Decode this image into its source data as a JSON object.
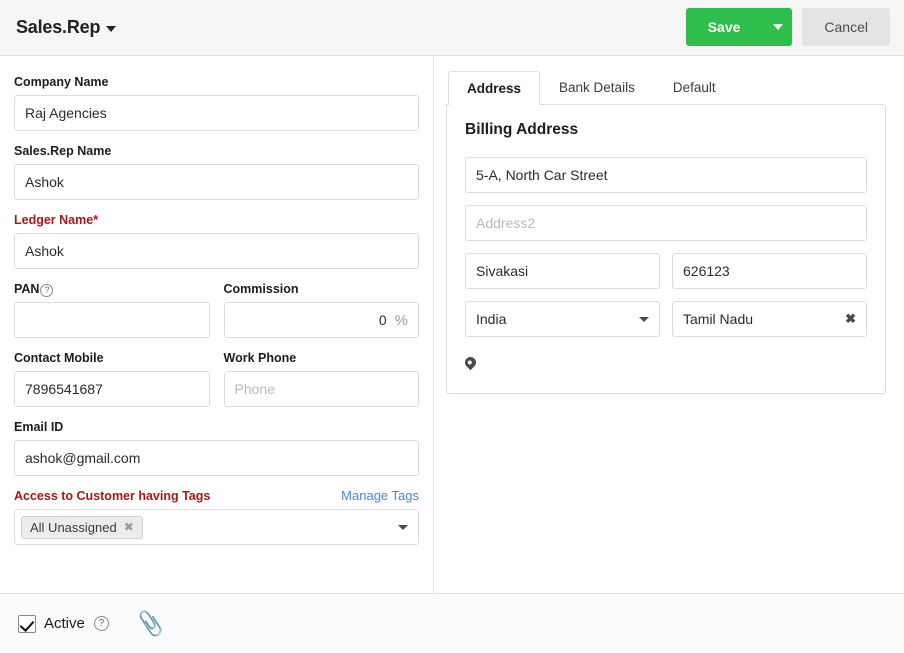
{
  "header": {
    "title": "Sales.Rep",
    "title_caret_icon": "chevron-down-icon",
    "save_label": "Save",
    "save_caret_icon": "chevron-down-icon",
    "cancel_label": "Cancel",
    "save_color": "#2fbd4b",
    "cancel_color": "#e4e4e4"
  },
  "form": {
    "company_name": {
      "label": "Company Name",
      "value": "Raj Agencies",
      "placeholder": ""
    },
    "sales_rep_name": {
      "label": "Sales.Rep Name",
      "value": "Ashok",
      "placeholder": ""
    },
    "ledger_name": {
      "label": "Ledger Name",
      "required_marker": "*",
      "value": "Ashok",
      "placeholder": "",
      "label_color": "#a01a1a"
    },
    "pan": {
      "label": "PAN",
      "help_icon": "question-circle-icon",
      "value": "",
      "placeholder": ""
    },
    "commission": {
      "label": "Commission",
      "value": "0",
      "suffix": "%"
    },
    "contact_mobile": {
      "label": "Contact Mobile",
      "value": "7896541687",
      "placeholder": ""
    },
    "work_phone": {
      "label": "Work Phone",
      "value": "",
      "placeholder": "Phone"
    },
    "email_id": {
      "label": "Email ID",
      "value": "ashok@gmail.com",
      "placeholder": ""
    },
    "tags": {
      "label": "Access to Customer having Tags",
      "label_color": "#a01a1a",
      "manage_link": "Manage Tags",
      "link_color": "#4a86c8",
      "chips": [
        {
          "text": "All Unassigned",
          "remove_icon": "close-icon"
        }
      ],
      "caret_icon": "chevron-down-icon"
    }
  },
  "tabs": [
    {
      "label": "Address",
      "active": true
    },
    {
      "label": "Bank Details",
      "active": false
    },
    {
      "label": "Default",
      "active": false
    }
  ],
  "address_panel": {
    "title": "Billing Address",
    "address1": {
      "value": "5-A, North Car Street",
      "placeholder": ""
    },
    "address2": {
      "value": "",
      "placeholder": "Address2"
    },
    "city": {
      "value": "Sivakasi",
      "placeholder": ""
    },
    "pincode": {
      "value": "626123",
      "placeholder": ""
    },
    "country": {
      "value": "India",
      "caret_icon": "chevron-down-icon"
    },
    "state": {
      "value": "Tamil Nadu",
      "clear_icon": "close-icon"
    },
    "map_icon": "map-pin-icon"
  },
  "footer": {
    "active_label": "Active",
    "active_checked": true,
    "active_help_icon": "question-circle-icon",
    "attachment_icon": "paperclip-icon",
    "attachment_glyph": "📎"
  }
}
